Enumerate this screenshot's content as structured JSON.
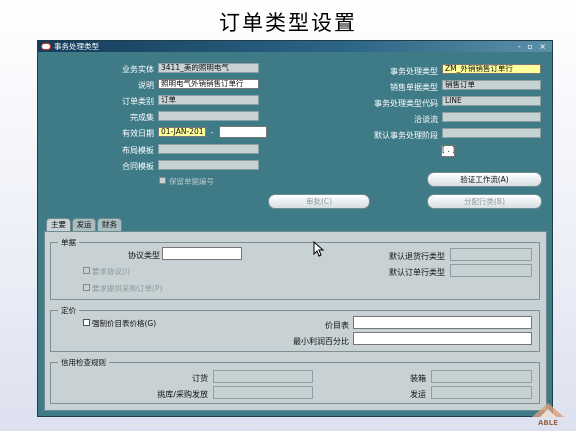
{
  "slide_title": "订单类型设置",
  "window": {
    "title": "事务处理类型",
    "controls": "- ▫ ×"
  },
  "header": {
    "left": [
      {
        "label": "业务实体",
        "value": "3411_美的照明电气"
      },
      {
        "label": "说明",
        "value": "照明电气外销销售订单行"
      },
      {
        "label": "订单类别",
        "value": "订单"
      },
      {
        "label": "完成集",
        "value": ""
      },
      {
        "label": "有效日期",
        "value": "01-JAN-201",
        "value_to": "",
        "sep": "-"
      },
      {
        "label": "布局模板",
        "value": ""
      },
      {
        "label": "合同模板",
        "value": ""
      }
    ],
    "retain_doc_number": "保留单据编号",
    "right": [
      {
        "label": "事务处理类型",
        "value": "ZM_外销销售订单行"
      },
      {
        "label": "销售单据类型",
        "value": "销售订单"
      },
      {
        "label": "事务处理类型代码",
        "value": "LINE"
      },
      {
        "label": "洽谈流",
        "value": ""
      },
      {
        "label": "默认事务处理阶段",
        "value": ""
      }
    ],
    "flex_bracket": "[ . ]",
    "buttons": {
      "validate_workflow": "验证工作流(A)",
      "approve": "审批(C)",
      "assign_lines": "分配行类(B)"
    }
  },
  "tabs": [
    "主要",
    "发运",
    "财务"
  ],
  "main": {
    "document": {
      "title": "单据",
      "agreement_type_label": "协议类型",
      "agreement_type_value": "",
      "require_agreement": "要求协议(I)",
      "require_po": "要求提供采购订单(P)",
      "default_return_line_label": "默认退货行类型",
      "default_order_line_label": "默认订单行类型"
    },
    "pricing": {
      "title": "定价",
      "enforce_price_list": "强制价目表价格(G)",
      "price_list_label": "价目表",
      "min_margin_label": "最小利润百分比"
    },
    "credit_check": {
      "title": "信用检查规则",
      "ordering_label": "订货",
      "packing_label": "装箱",
      "picking_label": "挑库/采购发放",
      "shipping_label": "发运"
    }
  },
  "logo_text": "ABLE"
}
